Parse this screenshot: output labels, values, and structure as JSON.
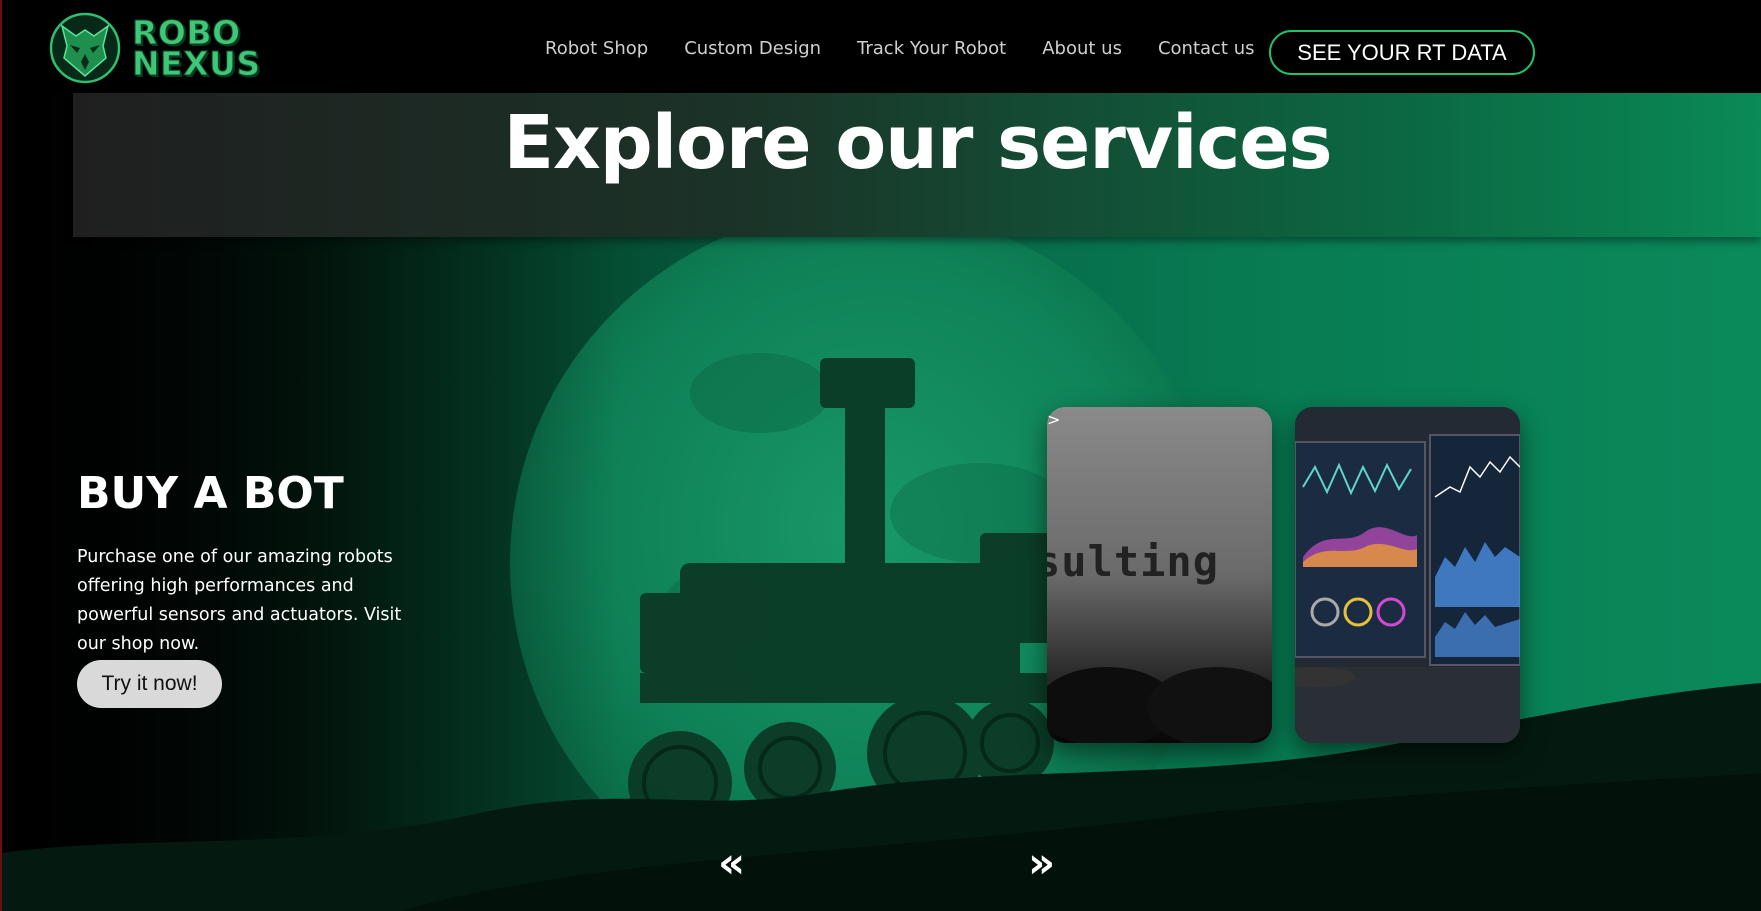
{
  "header": {
    "logo_line1": "ROBO",
    "logo_line2": "NEXUS",
    "nav": [
      "Robot Shop",
      "Custom Design",
      "Track Your Robot",
      "About us",
      "Contact us"
    ],
    "cta_label": "SEE YOUR RT DATA"
  },
  "banner": {
    "title": "Explore our services"
  },
  "slide": {
    "title": "BUY A BOT",
    "description": "Purchase one of our amazing robots offering high performances and powerful sensors and actuators. Visit our shop now.",
    "button_label": "Try it now!"
  },
  "cards": {
    "caret": ">",
    "card1_word": "sulting"
  },
  "carousel": {
    "prev_icon": "«",
    "next_icon": "»"
  },
  "colors": {
    "accent": "#20c26a",
    "logo_green": "#3ec777",
    "hero_green": "#087a52"
  },
  "icons": {
    "logo": "wolf-head-icon",
    "prev": "double-chevron-left-icon",
    "next": "double-chevron-right-icon"
  }
}
